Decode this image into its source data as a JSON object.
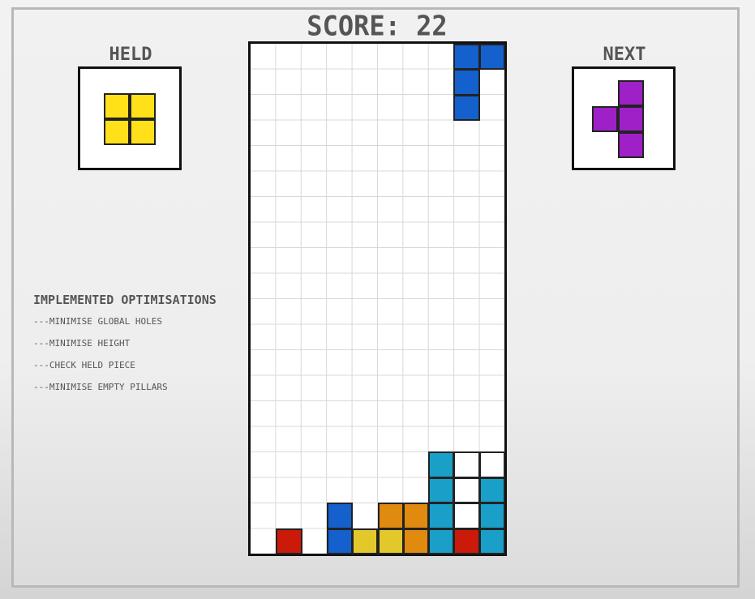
{
  "score_label": "SCORE: 22",
  "held": {
    "title": "HELD",
    "color": "#FFE019",
    "cells": [
      [
        0,
        0
      ],
      [
        1,
        0
      ],
      [
        0,
        1
      ],
      [
        1,
        1
      ]
    ]
  },
  "next": {
    "title": "NEXT",
    "color": "#A020C8",
    "cells": [
      [
        1,
        0
      ],
      [
        0,
        1
      ],
      [
        1,
        1
      ],
      [
        1,
        2
      ]
    ]
  },
  "optimisations": {
    "title": "IMPLEMENTED OPTIMISATIONS",
    "items": [
      "---MINIMISE GLOBAL HOLES",
      "---MINIMISE HEIGHT",
      "---CHECK HELD PIECE",
      "---MINIMISE EMPTY PILLARS"
    ]
  },
  "board": {
    "columns": 10,
    "rows": 20,
    "colors": {
      "blue": "#1460CC",
      "red": "#CC1A0A",
      "yellow": "#E3C82C",
      "orange": "#E08A10",
      "cyan": "#1AA0C8",
      "white": "#FFFFFF"
    },
    "active_piece": {
      "color": "blue",
      "cells": [
        [
          8,
          0
        ],
        [
          9,
          0
        ],
        [
          8,
          1
        ],
        [
          8,
          2
        ]
      ]
    },
    "stack": [
      {
        "col": 7,
        "row": 16,
        "color": "cyan"
      },
      {
        "col": 8,
        "row": 16,
        "color": "white"
      },
      {
        "col": 9,
        "row": 16,
        "color": "white"
      },
      {
        "col": 7,
        "row": 17,
        "color": "cyan"
      },
      {
        "col": 8,
        "row": 17,
        "color": "white"
      },
      {
        "col": 9,
        "row": 17,
        "color": "cyan"
      },
      {
        "col": 3,
        "row": 18,
        "color": "blue"
      },
      {
        "col": 5,
        "row": 18,
        "color": "orange"
      },
      {
        "col": 6,
        "row": 18,
        "color": "orange"
      },
      {
        "col": 7,
        "row": 18,
        "color": "cyan"
      },
      {
        "col": 8,
        "row": 18,
        "color": "white"
      },
      {
        "col": 9,
        "row": 18,
        "color": "cyan"
      },
      {
        "col": 1,
        "row": 19,
        "color": "red"
      },
      {
        "col": 3,
        "row": 19,
        "color": "blue"
      },
      {
        "col": 4,
        "row": 19,
        "color": "yellow"
      },
      {
        "col": 5,
        "row": 19,
        "color": "yellow"
      },
      {
        "col": 6,
        "row": 19,
        "color": "orange"
      },
      {
        "col": 7,
        "row": 19,
        "color": "cyan"
      },
      {
        "col": 8,
        "row": 19,
        "color": "red"
      },
      {
        "col": 9,
        "row": 19,
        "color": "cyan"
      }
    ]
  }
}
